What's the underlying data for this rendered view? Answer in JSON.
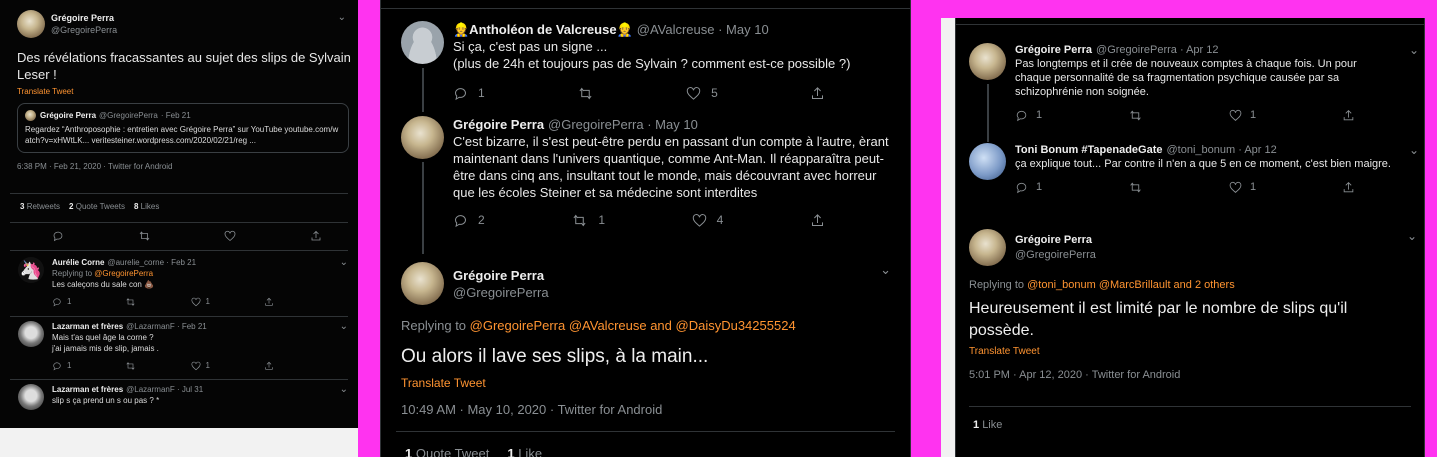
{
  "colors": {
    "accent": "#ff9431",
    "background": "#000000",
    "magenta": "#ff33f0"
  },
  "p1": {
    "main": {
      "author": "Grégoire Perra",
      "handle": "@GregoirePerra",
      "text": "Des révélations fracassantes au sujet des slips de Sylvain Leser !",
      "translate": "Translate Tweet",
      "quote": {
        "author": "Grégoire Perra",
        "handle": "@GregoirePerra",
        "date": "· Feb 21",
        "text": "Regardez “Anthroposophie : entretien avec Grégoire Perra” sur YouTube youtube.com/watch?v=xHWtLK... veritesteiner.wordpress.com/2020/02/21/reg ..."
      },
      "timestamp": "6:38 PM · Feb 21, 2020 · Twitter for Android",
      "stats": [
        {
          "n": "3",
          "label": "Retweets"
        },
        {
          "n": "2",
          "label": "Quote Tweets"
        },
        {
          "n": "8",
          "label": "Likes"
        }
      ]
    },
    "replies": [
      {
        "author": "Aurélie Corne",
        "handle": "@aurelie_corne · Feb 21",
        "replying": "Replying to",
        "replying_to": "@GregoirePerra",
        "text": "Les caleçons du sale con 💩",
        "c": "1",
        "l": "1"
      },
      {
        "author": "Lazarman et frères",
        "handle": "@LazarmanF · Feb 21",
        "text1": "Mais t'as quel âge la corne ?",
        "text2": "j'ai jamais mis de slip, jamais .",
        "c": "1",
        "l": "1"
      },
      {
        "author": "Lazarman et frères",
        "handle": "@LazarmanF · Jul 31",
        "text": "slip s ça prend un s ou pas ? *"
      }
    ]
  },
  "p2": {
    "t1": {
      "author": "👷Antholéon de Valcreuse👷",
      "handle": "@AValcreuse · May 10",
      "text1": "Si ça, c'est pas un signe ...",
      "text2": "(plus de 24h et toujours pas de Sylvain ? comment est-ce possible ?)",
      "c": "1",
      "r": "",
      "l": "5"
    },
    "t2": {
      "author": "Grégoire Perra",
      "handle": "@GregoirePerra · May 10",
      "text": "C'est bizarre, il s'est peut-être perdu en passant d'un compte à l'autre, èrant maintenant dans l'univers quantique, comme Ant-Man. Il réapparaîtra peut-être dans cinq ans, insultant tout le monde, mais découvrant avec horreur que les écoles Steiner et sa médecine sont interdites",
      "c": "2",
      "r": "1",
      "l": "4"
    },
    "main": {
      "author": "Grégoire Perra",
      "handle": "@GregoirePerra",
      "replying": "Replying to",
      "replying_to": "@GregoirePerra @AValcreuse and @DaisyDu34255524",
      "text": "Ou alors il lave ses slips, à la main...",
      "translate": "Translate Tweet",
      "timestamp": "10:49 AM · May 10, 2020 · Twitter for Android",
      "stats": [
        {
          "n": "1",
          "label": "Quote Tweet"
        },
        {
          "n": "1",
          "label": "Like"
        }
      ]
    }
  },
  "p3": {
    "t1": {
      "author": "Grégoire Perra",
      "handle": "@GregoirePerra · Apr 12",
      "text": "Pas longtemps et il crée de nouveaux comptes à chaque fois. Un pour chaque personnalité de sa fragmentation psychique causée par sa schizophrénie non soignée.",
      "c": "1",
      "l": "1"
    },
    "t2": {
      "author": "Toni Bonum #TapenadeGate",
      "handle": "@toni_bonum · Apr 12",
      "text": "ça explique tout... Par contre il n'en a que 5 en ce moment, c'est bien maigre.",
      "c": "1",
      "l": "1"
    },
    "main": {
      "author": "Grégoire Perra",
      "handle": "@GregoirePerra",
      "replying": "Replying to",
      "replying_to": "@toni_bonum @MarcBrillault and 2 others",
      "text": "Heureusement il est limité par le nombre de slips qu'il possède.",
      "translate": "Translate Tweet",
      "timestamp": "5:01 PM · Apr 12, 2020 · Twitter for Android",
      "stats": [
        {
          "n": "1",
          "label": "Like"
        }
      ]
    }
  }
}
